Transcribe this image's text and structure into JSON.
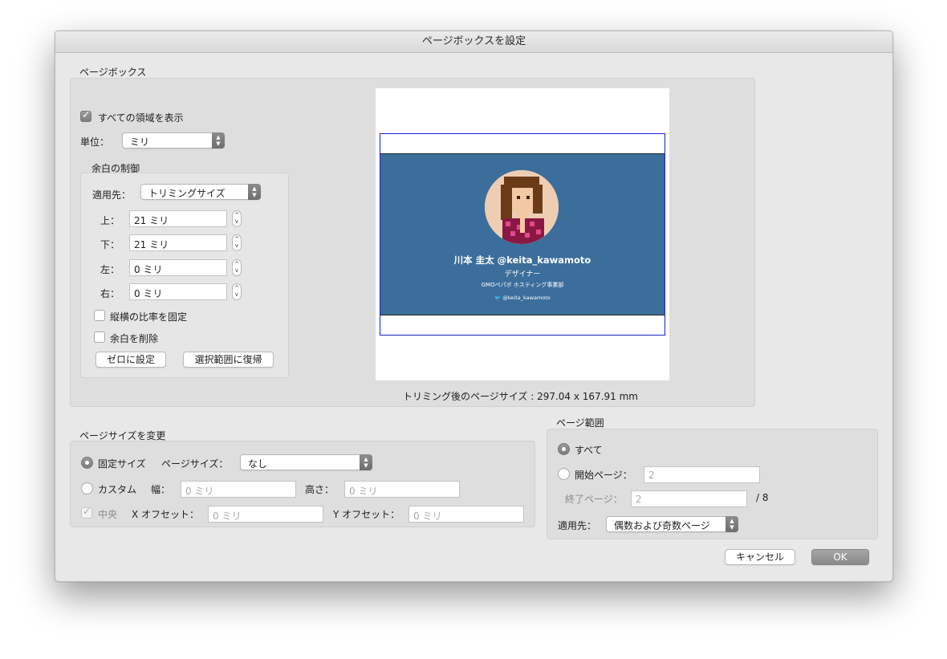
{
  "dialog": {
    "title": "ページボックスを設定"
  },
  "page_box": {
    "label": "ページボックス",
    "show_all_boxes": {
      "label": "すべての領域を表示",
      "checked": true
    },
    "unit": {
      "label": "単位：",
      "value": "ミリ"
    },
    "margin_control": {
      "label": "余白の制御",
      "apply_to": {
        "label": "適用先：",
        "value": "トリミングサイズ"
      },
      "top": {
        "label": "上：",
        "value": "21 ミリ"
      },
      "bottom": {
        "label": "下：",
        "value": "21 ミリ"
      },
      "left": {
        "label": "左：",
        "value": "0 ミリ"
      },
      "right": {
        "label": "右：",
        "value": "0 ミリ"
      },
      "constrain": {
        "label": "縦横の比率を固定",
        "checked": false
      },
      "remove_white_margins": {
        "label": "余白を削除",
        "checked": false
      },
      "set_to_zero_label": "ゼロに設定",
      "revert_label": "選択範囲に復帰"
    },
    "preview": {
      "card": {
        "name": "川本 圭太 @keita_kawamoto",
        "role": "デザイナー",
        "company": "GMOペパボ ホスティング事業部",
        "twitter": "@keita_kawamoto"
      },
      "cropped_size": "トリミング後のページサイズ : 297.04 x 167.91 mm"
    }
  },
  "change_page_size": {
    "label": "ページサイズを変更",
    "fixed": {
      "label": "固定サイズ",
      "selected": true
    },
    "page_size": {
      "label": "ページサイズ：",
      "value": "なし"
    },
    "custom": {
      "label": "カスタム",
      "selected": false
    },
    "width": {
      "label": "幅：",
      "placeholder": "0 ミリ"
    },
    "height": {
      "label": "高さ：",
      "placeholder": "0 ミリ"
    },
    "center": {
      "label": "中央",
      "checked": true
    },
    "x_offset": {
      "label": "X オフセット：",
      "placeholder": "0 ミリ"
    },
    "y_offset": {
      "label": "Y オフセット：",
      "placeholder": "0 ミリ"
    }
  },
  "page_range": {
    "label": "ページ範囲",
    "all": {
      "label": "すべて",
      "selected": true
    },
    "from": {
      "label": "開始ページ：",
      "value": "2",
      "selected": false
    },
    "to": {
      "label": "終了ページ：",
      "value": "2"
    },
    "total": "/ 8",
    "apply_to": {
      "label": "適用先：",
      "value": "偶数および奇数ページ"
    }
  },
  "buttons": {
    "cancel": "キャンセル",
    "ok": "OK"
  },
  "colors": {
    "card_background": "#3b6e9b",
    "trim_box": "#1a22c9"
  }
}
